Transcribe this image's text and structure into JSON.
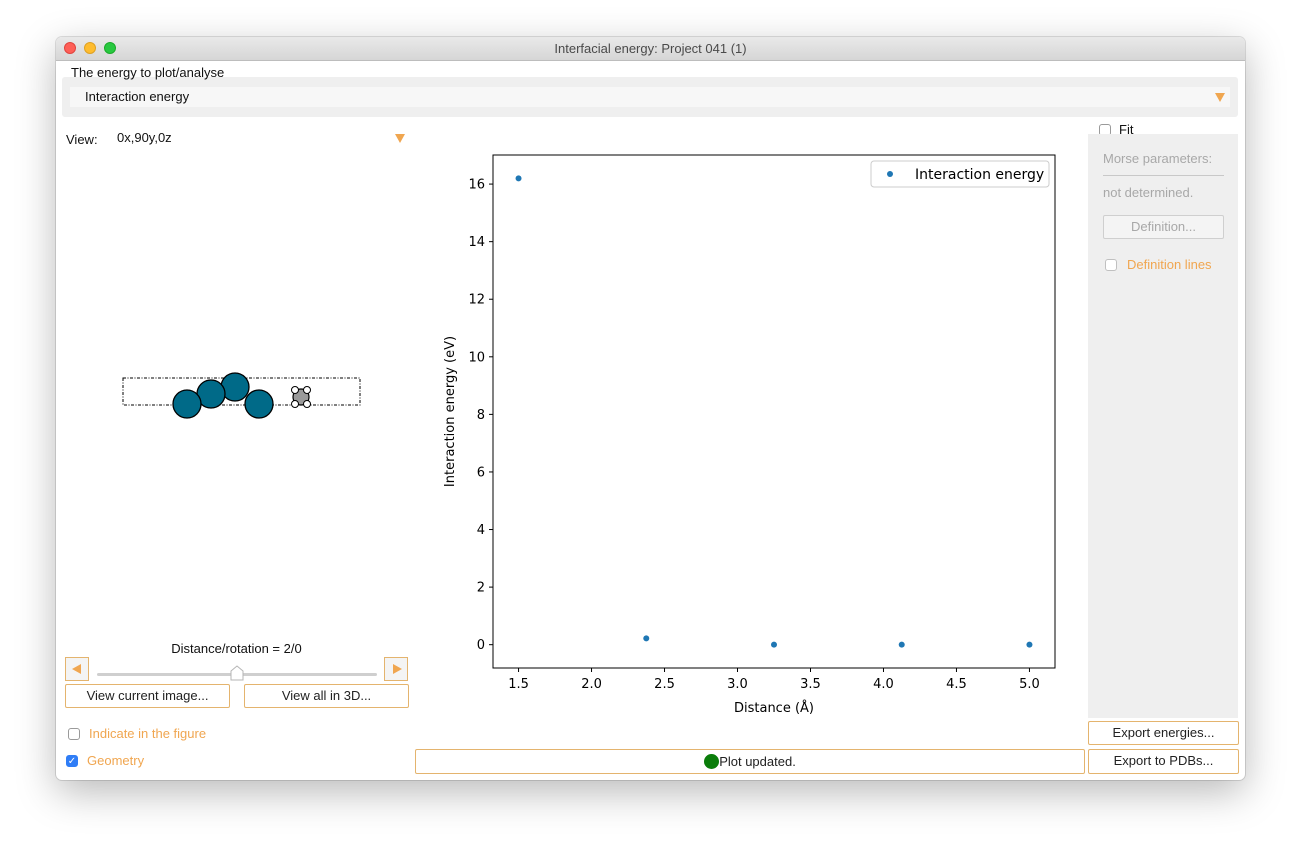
{
  "window": {
    "title": "Interfacial energy: Project 041 (1)"
  },
  "energy_selector": {
    "group_label": "The energy to plot/analyse",
    "selected": "Interaction energy"
  },
  "view": {
    "label": "View:",
    "selected": "0x,90y,0z"
  },
  "slider": {
    "label": "Distance/rotation = 2/0",
    "value": 2,
    "max": 4
  },
  "buttons": {
    "view_current_image": "View current image...",
    "view_all_3d": "View all in 3D...",
    "definition": "Definition...",
    "export_energies": "Export energies...",
    "export_pdbs": "Export to PDBs..."
  },
  "checkboxes": {
    "indicate_in_figure": {
      "label": "Indicate in the figure",
      "checked": false
    },
    "geometry": {
      "label": "Geometry",
      "checked": true
    },
    "fit": {
      "label": "Fit",
      "checked": false
    },
    "definition_lines": {
      "label": "Definition lines",
      "checked": false
    }
  },
  "morse": {
    "parameters_label": "Morse parameters:",
    "status": "not determined."
  },
  "status": {
    "message": "Plot updated.",
    "indicator_color": "#0a7d0a"
  },
  "colors": {
    "accent": "#f0a650",
    "series": "#1f77b4",
    "atom_large": "#006a88",
    "atom_small": "#9a9a9a"
  },
  "chart_data": {
    "type": "scatter",
    "series": [
      {
        "name": "Interaction energy",
        "x": [
          1.5,
          2.375,
          3.25,
          4.125,
          5.0
        ],
        "y": [
          16.2,
          0.22,
          0.0,
          0.0,
          0.0
        ]
      }
    ],
    "xlabel": "Distance (Å)",
    "ylabel": "Interaction energy (eV)",
    "xlim": [
      1.325,
      5.175
    ],
    "ylim": [
      -0.81,
      17.01
    ],
    "xticks": [
      1.5,
      2.0,
      2.5,
      3.0,
      3.5,
      4.0,
      4.5,
      5.0
    ],
    "xtick_labels": [
      "1.5",
      "2.0",
      "2.5",
      "3.0",
      "3.5",
      "4.0",
      "4.5",
      "5.0"
    ],
    "yticks": [
      0,
      2,
      4,
      6,
      8,
      10,
      12,
      14,
      16
    ],
    "ytick_labels": [
      "0",
      "2",
      "4",
      "6",
      "8",
      "10",
      "12",
      "14",
      "16"
    ],
    "legend": "top-right",
    "grid": false
  }
}
